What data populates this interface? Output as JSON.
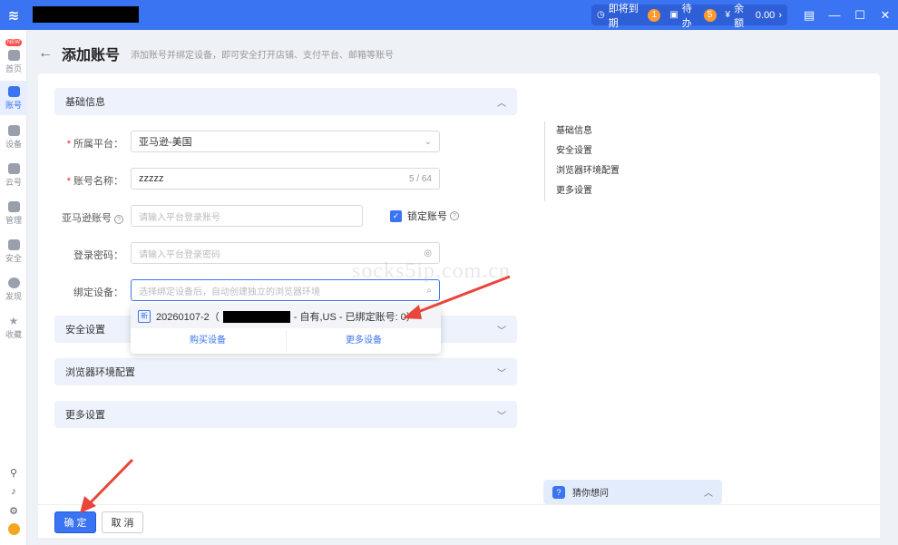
{
  "titlebar": {
    "expiring_label": "即将到期",
    "expiring_count": "1",
    "todo_label": "待办",
    "todo_count": "5",
    "balance_label": "余额",
    "balance_value": "0.00"
  },
  "sidebar": {
    "new_badge": "NEW",
    "items": [
      {
        "label": "首页"
      },
      {
        "label": "账号"
      },
      {
        "label": "设备"
      },
      {
        "label": "云号"
      },
      {
        "label": "管理"
      },
      {
        "label": "安全"
      },
      {
        "label": "发现"
      },
      {
        "label": "收藏"
      }
    ]
  },
  "header": {
    "title": "添加账号",
    "subtitle": "添加账号并绑定设备，即可安全打开店铺、支付平台、邮箱等账号"
  },
  "sections": {
    "basic": "基础信息",
    "security": "安全设置",
    "browser": "浏览器环境配置",
    "more": "更多设置"
  },
  "form": {
    "platform_label": "所属平台：",
    "platform_value": "亚马逊-美国",
    "name_label": "账号名称：",
    "name_value": "zzzzz",
    "name_count": "5 / 64",
    "amazon_label": "亚马逊账号",
    "amazon_placeholder": "请输入平台登录账号",
    "lock_label": "锁定账号",
    "password_label": "登录密码：",
    "password_placeholder": "请输入平台登录密码",
    "device_label": "绑定设备：",
    "device_placeholder": "选择绑定设备后，自动创建独立的浏览器环境"
  },
  "dropdown": {
    "new_tag": "新",
    "device_name": "20260107-2（",
    "device_detail": "- 自有,US - 已绑定账号: 0）",
    "buy_label": "购买设备",
    "more_label": "更多设备"
  },
  "anchor_nav": [
    "基础信息",
    "安全设置",
    "浏览器环境配置",
    "更多设置"
  ],
  "watermark": "socks5ip.com.cn",
  "guess": "猜你想问",
  "footer": {
    "confirm": "确 定",
    "cancel": "取 消"
  },
  "colors": {
    "accent": "#3a74f2",
    "badge": "#ff9a2e",
    "annotation_arrow": "#e8463a"
  }
}
